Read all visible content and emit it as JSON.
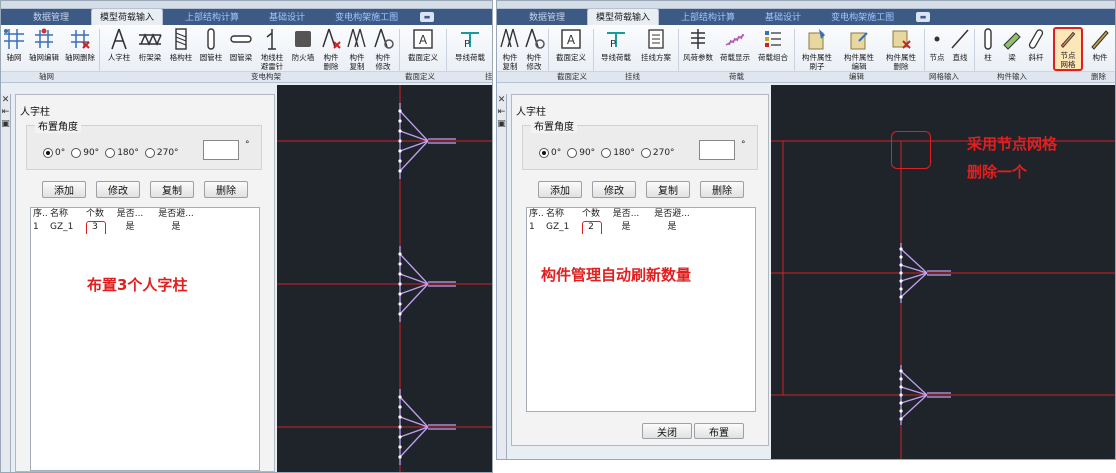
{
  "left_shot": {
    "tabs": [
      "数据管理",
      "模型荷载输入",
      "上部结构计算",
      "基础设计",
      "变电构架施工图"
    ],
    "active_tab": 1,
    "ribbon_buttons": [
      {
        "label": "轴网",
        "icon": "grid-icon"
      },
      {
        "label": "轴网编辑",
        "icon": "grid-edit-icon"
      },
      {
        "label": "轴网删除",
        "icon": "grid-delete-icon"
      },
      {
        "label": "人字柱",
        "icon": "a-frame-column-icon"
      },
      {
        "label": "桁架梁",
        "icon": "truss-beam-icon"
      },
      {
        "label": "格构柱",
        "icon": "lattice-column-icon"
      },
      {
        "label": "圆管柱",
        "icon": "round-tube-column-icon"
      },
      {
        "label": "圆管梁",
        "icon": "round-tube-beam-icon"
      },
      {
        "label": "地线柱\n避雷针",
        "icon": "lightning-rod-icon"
      },
      {
        "label": "防火墙",
        "icon": "firewall-icon"
      },
      {
        "label": "构件\n删除",
        "icon": "component-delete-icon"
      },
      {
        "label": "构件\n复制",
        "icon": "component-copy-icon"
      },
      {
        "label": "构件\n修改",
        "icon": "component-modify-icon"
      },
      {
        "label": "截面定义",
        "icon": "section-define-icon"
      },
      {
        "label": "导线荷载",
        "icon": "wire-load-icon"
      }
    ],
    "ribbon_groups": [
      "轴网",
      "变电构架",
      "截面定义",
      "挂"
    ],
    "panel": {
      "title": "人字柱",
      "group_title": "布置角度",
      "angles": [
        "0°",
        "90°",
        "180°",
        "270°"
      ],
      "selected_angle": 0,
      "degree_symbol": "°",
      "buttons": [
        "添加",
        "修改",
        "复制",
        "删除"
      ],
      "columns": [
        "序...",
        "名称",
        "个数",
        "是否...",
        "是否避..."
      ],
      "rows": [
        {
          "index": "1",
          "name": "GZ_1",
          "count": "3",
          "flag1": "是",
          "flag2": "是"
        }
      ]
    },
    "annotation": "布置3个人字柱"
  },
  "right_shot": {
    "tabs": [
      "数据管理",
      "模型荷载输入",
      "上部结构计算",
      "基础设计",
      "变电构架施工图"
    ],
    "active_tab": 1,
    "ribbon_buttons": [
      {
        "label": "构件\n复制",
        "icon": "component-copy-icon"
      },
      {
        "label": "构件\n修改",
        "icon": "component-modify-icon"
      },
      {
        "label": "截面定义",
        "icon": "section-define-icon"
      },
      {
        "label": "导线荷载",
        "icon": "wire-load-icon"
      },
      {
        "label": "挂线方案",
        "icon": "hanging-scheme-icon"
      },
      {
        "label": "风荷参数",
        "icon": "wind-load-icon"
      },
      {
        "label": "荷载显示",
        "icon": "load-display-icon"
      },
      {
        "label": "荷载组合",
        "icon": "load-combination-icon"
      },
      {
        "label": "构件属性\n刷子",
        "icon": "property-brush-icon"
      },
      {
        "label": "构件属性\n编辑",
        "icon": "property-edit-icon"
      },
      {
        "label": "构件属性\n删除",
        "icon": "property-delete-icon"
      },
      {
        "label": "节点",
        "icon": "node-icon"
      },
      {
        "label": "直线",
        "icon": "line-icon"
      },
      {
        "label": "柱",
        "icon": "column-icon"
      },
      {
        "label": "梁",
        "icon": "beam-icon"
      },
      {
        "label": "斜杆",
        "icon": "brace-icon"
      },
      {
        "label": "节点\n网格",
        "icon": "node-grid-delete-icon"
      },
      {
        "label": "构件",
        "icon": "component-delete-brush-icon"
      }
    ],
    "ribbon_groups": [
      "截面定义",
      "挂线",
      "荷载",
      "编辑",
      "网格输入",
      "构件输入",
      "删除"
    ],
    "tooltip": "删除",
    "panel": {
      "title": "人字柱",
      "group_title": "布置角度",
      "angles": [
        "0°",
        "90°",
        "180°",
        "270°"
      ],
      "selected_angle": 0,
      "degree_symbol": "°",
      "buttons": [
        "添加",
        "修改",
        "复制",
        "删除"
      ],
      "columns": [
        "序...",
        "名称",
        "个数",
        "是否...",
        "是否避..."
      ],
      "rows": [
        {
          "index": "1",
          "name": "GZ_1",
          "count": "2",
          "flag1": "是",
          "flag2": "是"
        }
      ],
      "footer_buttons": [
        "关闭",
        "布置"
      ]
    },
    "annotation_table": "构件管理自动刷新数量",
    "annotation_canvas": [
      "采用节点网格",
      "删除一个"
    ]
  },
  "colors": {
    "annotation_red": "#e02020",
    "canvas_bg": "#1f232a",
    "grid_line": "#d0202a",
    "column_glyph": "#b890e0",
    "tab_bar": "#3d5a85"
  }
}
